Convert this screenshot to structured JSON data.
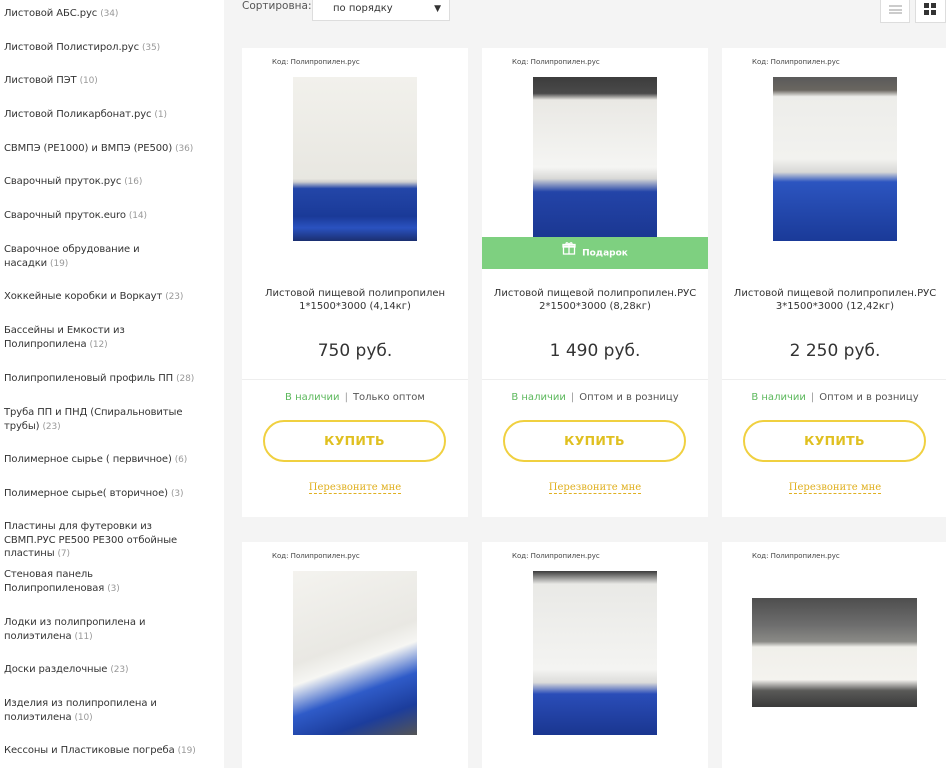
{
  "sidebar": {
    "categories": [
      {
        "label": "Листовой АБС.рус",
        "count": "(34)"
      },
      {
        "label": "Листовой Полистирол.рус",
        "count": "(35)"
      },
      {
        "label": "Листовой ПЭТ",
        "count": "(10)"
      },
      {
        "label": "Листовой Поликарбонат.рус",
        "count": "(1)"
      },
      {
        "label": "СВМПЭ (PE1000) и ВМПЭ (PE500)",
        "count": "(36)"
      },
      {
        "label": "Сварочный пруток.рус",
        "count": "(16)"
      },
      {
        "label": "Сварочный пруток.euro",
        "count": "(14)"
      },
      {
        "label": "Сварочное обрудование и насадки",
        "count": "(19)"
      },
      {
        "label": "Хоккейные коробки и Воркаут",
        "count": "(23)"
      },
      {
        "label": "Бассейны и Емкости из Полипропилена",
        "count": "(12)"
      },
      {
        "label": "Полипропиленовый профиль ПП",
        "count": "(28)"
      },
      {
        "label": "Труба ПП и ПНД (Спиральновитые трубы)",
        "count": "(23)"
      },
      {
        "label": "Полимерное сырье ( первичное)",
        "count": "(6)"
      },
      {
        "label": "Полимерное сырье( вторичное)",
        "count": "(3)"
      },
      {
        "label": "Пластины для футеровки из СВМП.РУС PE500 PE300 отбойные пластины",
        "count": "(7)"
      },
      {
        "label": "Стеновая панель Полипропиленовая",
        "count": "(3)"
      },
      {
        "label": "Лодки из полипропилена и полиэтилена",
        "count": "(11)"
      },
      {
        "label": "Доски разделочные",
        "count": "(23)"
      },
      {
        "label": "Изделия из полипропилена и полиэтилена",
        "count": "(10)"
      },
      {
        "label": "Кессоны и Пластиковые погреба",
        "count": "(19)"
      }
    ]
  },
  "toolbar": {
    "sort_label": "Сортировна:",
    "sort_value": "по порядку",
    "sort_arrow": "▼",
    "icons": {
      "list": "list-view-icon",
      "grid": "grid-view-icon"
    }
  },
  "products": [
    {
      "code": "Код: Полипропилен.рус",
      "title": "Листовой пищевой полипропилен 1*1500*3000 (4,14кг)",
      "price": "750 руб.",
      "stock": "В наличии",
      "sep": "|",
      "sale": "Только оптом",
      "buy_label": "КУПИТЬ",
      "callback": "Перезвоните мне"
    },
    {
      "code": "Код: Полипропилен.рус",
      "title": "Листовой пищевой полипропилен.РУС 2*1500*3000 (8,28кг)",
      "price": "1 490 руб.",
      "stock": "В наличии",
      "sep": "|",
      "sale": "Оптом и в розницу",
      "buy_label": "КУПИТЬ",
      "callback": "Перезвоните мне",
      "gift": "Подарок"
    },
    {
      "code": "Код: Полипропилен.рус",
      "title": "Листовой пищевой полипропилен.РУС 3*1500*3000 (12,42кг)",
      "price": "2 250 руб.",
      "stock": "В наличии",
      "sep": "|",
      "sale": "Оптом и в розницу",
      "buy_label": "КУПИТЬ",
      "callback": "Перезвоните мне"
    },
    {
      "code": "Код: Полипропилен.рус"
    },
    {
      "code": "Код: Полипропилен.рус"
    },
    {
      "code": "Код: Полипропилен.рус"
    }
  ],
  "colors": {
    "accent_yellow": "#f0d040",
    "stock_green": "#5cb85c",
    "gift_green": "#7ed080"
  }
}
